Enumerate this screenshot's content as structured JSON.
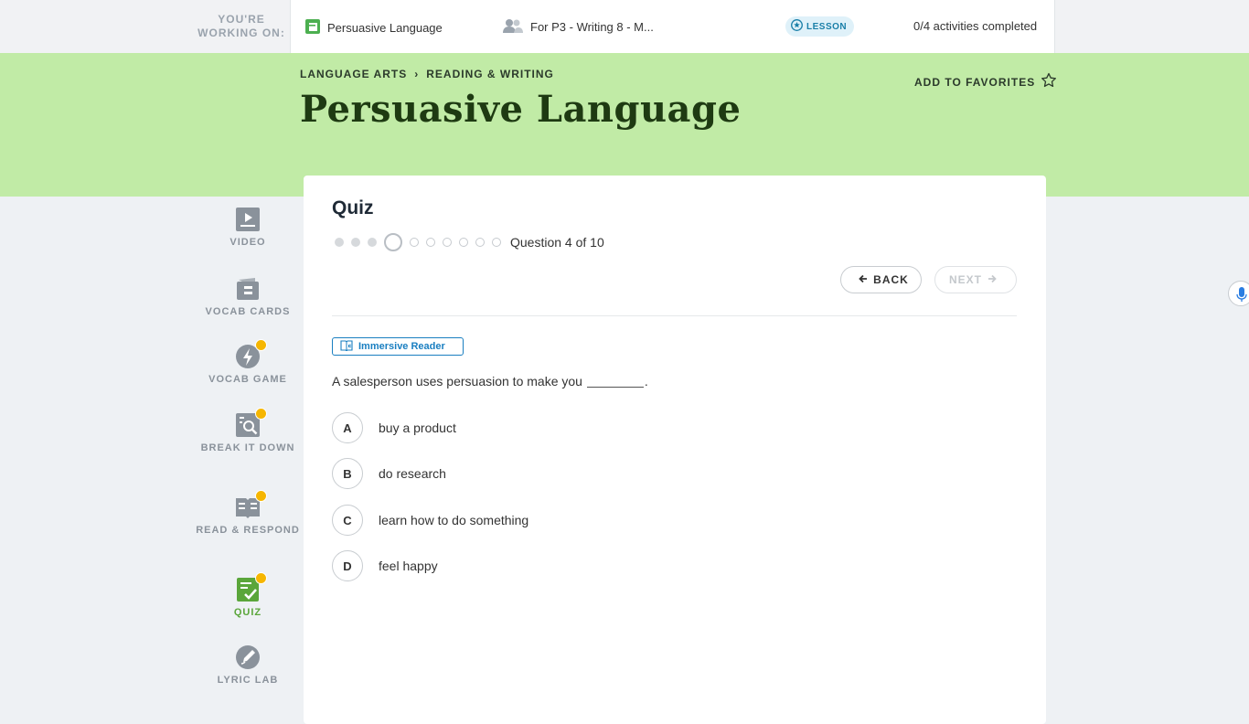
{
  "topbar": {
    "working_on": "YOU'RE WORKING ON:",
    "lesson_title": "Persuasive Language",
    "class_name": "For P3 - Writing 8 - M...",
    "badge": "LESSON",
    "activities": "0/4 activities completed"
  },
  "hero": {
    "crumb1": "LANGUAGE ARTS",
    "crumb2": "READING & WRITING",
    "title": "Persuasive Language",
    "favorites": "ADD TO FAVORITES"
  },
  "sidenav": {
    "items": [
      {
        "label": "VIDEO",
        "icon": "video-icon"
      },
      {
        "label": "VOCAB CARDS",
        "icon": "vocab-cards-icon"
      },
      {
        "label": "VOCAB GAME",
        "icon": "lightning-icon"
      },
      {
        "label": "BREAK IT DOWN",
        "icon": "magnify-doc-icon"
      },
      {
        "label": "READ & RESPOND",
        "icon": "book-icon"
      },
      {
        "label": "QUIZ",
        "icon": "quiz-check-icon"
      },
      {
        "label": "LYRIC LAB",
        "icon": "pen-icon"
      }
    ]
  },
  "quiz": {
    "heading": "Quiz",
    "progress": {
      "current": 4,
      "total": 10
    },
    "question_label": "Question 4 of 10",
    "back": "BACK",
    "next": "NEXT",
    "immersive": "Immersive Reader",
    "question_before": "A salesperson uses persuasion to make you",
    "question_after": ".",
    "answers": [
      {
        "letter": "A",
        "text": "buy a product"
      },
      {
        "letter": "B",
        "text": "do research"
      },
      {
        "letter": "C",
        "text": "learn how to do something"
      },
      {
        "letter": "D",
        "text": "feel happy"
      }
    ]
  },
  "colors": {
    "hero_bg": "#c1eba6",
    "title": "#1e3a12",
    "notification_dot": "#f6b600",
    "active_nav": "#5aa63a",
    "accent_blue": "#1a7fc1"
  }
}
